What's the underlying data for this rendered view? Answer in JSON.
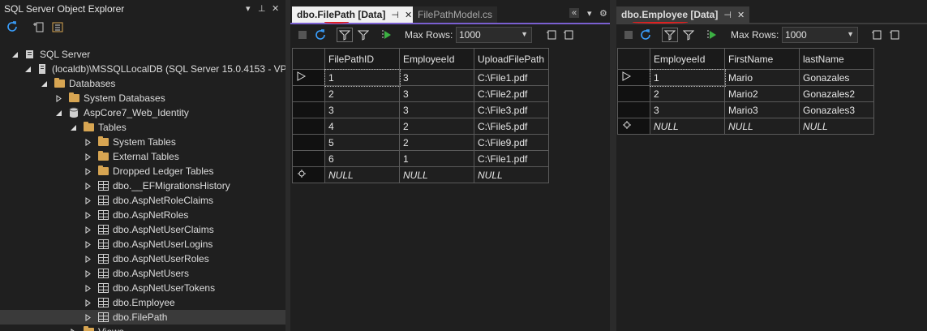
{
  "object_explorer": {
    "title": "SQL Server Object Explorer",
    "tree": [
      {
        "label": "SQL Server",
        "indent": 0,
        "twist": "open",
        "icon": "server-group-icon"
      },
      {
        "label": "(localdb)\\MSSQLLocalDB (SQL Server 15.0.4153 - VP...",
        "indent": 1,
        "twist": "open",
        "icon": "server-icon"
      },
      {
        "label": "Databases",
        "indent": 2,
        "twist": "open",
        "icon": "folder-icon"
      },
      {
        "label": "System Databases",
        "indent": 3,
        "twist": "closed",
        "icon": "folder-icon"
      },
      {
        "label": "AspCore7_Web_Identity",
        "indent": 3,
        "twist": "open",
        "icon": "database-icon"
      },
      {
        "label": "Tables",
        "indent": 4,
        "twist": "open",
        "icon": "folder-icon"
      },
      {
        "label": "System Tables",
        "indent": 5,
        "twist": "closed",
        "icon": "folder-icon"
      },
      {
        "label": "External Tables",
        "indent": 5,
        "twist": "closed",
        "icon": "folder-icon"
      },
      {
        "label": "Dropped Ledger Tables",
        "indent": 5,
        "twist": "closed",
        "icon": "folder-icon"
      },
      {
        "label": "dbo.__EFMigrationsHistory",
        "indent": 5,
        "twist": "closed",
        "icon": "table-icon"
      },
      {
        "label": "dbo.AspNetRoleClaims",
        "indent": 5,
        "twist": "closed",
        "icon": "table-icon"
      },
      {
        "label": "dbo.AspNetRoles",
        "indent": 5,
        "twist": "closed",
        "icon": "table-icon"
      },
      {
        "label": "dbo.AspNetUserClaims",
        "indent": 5,
        "twist": "closed",
        "icon": "table-icon"
      },
      {
        "label": "dbo.AspNetUserLogins",
        "indent": 5,
        "twist": "closed",
        "icon": "table-icon"
      },
      {
        "label": "dbo.AspNetUserRoles",
        "indent": 5,
        "twist": "closed",
        "icon": "table-icon"
      },
      {
        "label": "dbo.AspNetUsers",
        "indent": 5,
        "twist": "closed",
        "icon": "table-icon"
      },
      {
        "label": "dbo.AspNetUserTokens",
        "indent": 5,
        "twist": "closed",
        "icon": "table-icon"
      },
      {
        "label": "dbo.Employee",
        "indent": 5,
        "twist": "closed",
        "icon": "table-icon"
      },
      {
        "label": "dbo.FilePath",
        "indent": 5,
        "twist": "closed",
        "icon": "table-icon",
        "selected": true
      },
      {
        "label": "Views",
        "indent": 4,
        "twist": "closed",
        "icon": "folder-icon"
      }
    ]
  },
  "pane1": {
    "tabs": [
      {
        "label": "dbo.FilePath [Data]",
        "active": true
      },
      {
        "label": "FilePathModel.cs",
        "active": false
      }
    ],
    "max_rows_label": "Max Rows:",
    "max_rows_value": "1000",
    "columns": [
      "FilePathID",
      "EmployeeId",
      "UploadFilePath"
    ],
    "rows": [
      [
        "1",
        "3",
        "C:\\File1.pdf"
      ],
      [
        "2",
        "3",
        "C:\\File2.pdf"
      ],
      [
        "3",
        "3",
        "C:\\File3.pdf"
      ],
      [
        "4",
        "2",
        "C:\\File5.pdf"
      ],
      [
        "5",
        "2",
        "C:\\File9.pdf"
      ],
      [
        "6",
        "1",
        "C:\\File1.pdf"
      ]
    ],
    "null_label": "NULL"
  },
  "pane2": {
    "tabs": [
      {
        "label": "dbo.Employee [Data]",
        "active": true
      }
    ],
    "max_rows_label": "Max Rows:",
    "max_rows_value": "1000",
    "columns": [
      "EmployeeId",
      "FirstName",
      "lastName"
    ],
    "rows": [
      [
        "1",
        "Mario",
        "Gonazales"
      ],
      [
        "2",
        "Mario2",
        "Gonazales2"
      ],
      [
        "3",
        "Mario3",
        "Gonazales3"
      ]
    ],
    "null_label": "NULL"
  },
  "colors": {
    "accent": "#7a5fd0",
    "annotation_red": "#e02020",
    "folder": "#d7a552"
  }
}
